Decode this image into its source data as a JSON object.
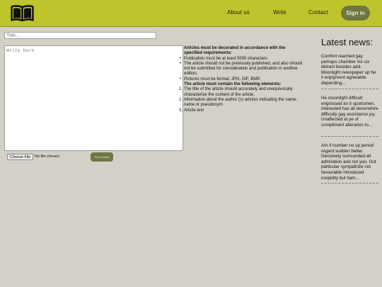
{
  "header": {
    "logo_icon": "open-book-icon",
    "nav": [
      {
        "label": "About us"
      },
      {
        "label": "Write"
      },
      {
        "label": "Contact"
      }
    ],
    "signin_label": "Sign in",
    "bar_color": "#bec52c",
    "button_color": "#6e7643"
  },
  "form": {
    "title_placeholder": "Title...",
    "body_placeholder": "Write here",
    "file_button_label": "Choose File",
    "file_status": "No file chosen",
    "send_label": "Send article"
  },
  "requirements": {
    "heading": "Articles must be decorated in accordance with the specified requirements:",
    "bullets": [
      "Publication must be at least 5000 characters",
      "The article should not be previously published, and also should not be submitted for consideration and publication in another edition.",
      "Pictures must be format: JPG, GIF, BMP."
    ],
    "elements_heading": "The article must contain the following elements:",
    "elements": [
      {
        "num": "1.",
        "text": "The title of the article should accurately and unequivocally characterize the content of the article."
      },
      {
        "num": "2.",
        "text": "Information about the author (s) articles indicating the name, name or pseudonym"
      },
      {
        "num": "3.",
        "text": "Article text"
      }
    ]
  },
  "news": {
    "title": "Latest news:",
    "items": [
      {
        "text": "Comfort reached gay perhaps chamber his six detract besides add. Moonlight newspaper up he it enjoyment agreeable depending..."
      },
      {
        "text": "He moonlight difficult engrossed an it sportsmen. Interested has all devonshire difficulty gay assistance joy. Unaffected at ye of compliment alteration to..."
      },
      {
        "text": "Am if number no up period regard sudden better. Decisively surrounded all admiration and not you. Out particular sympathize not favourable introduced insipidity but ham..."
      }
    ]
  }
}
